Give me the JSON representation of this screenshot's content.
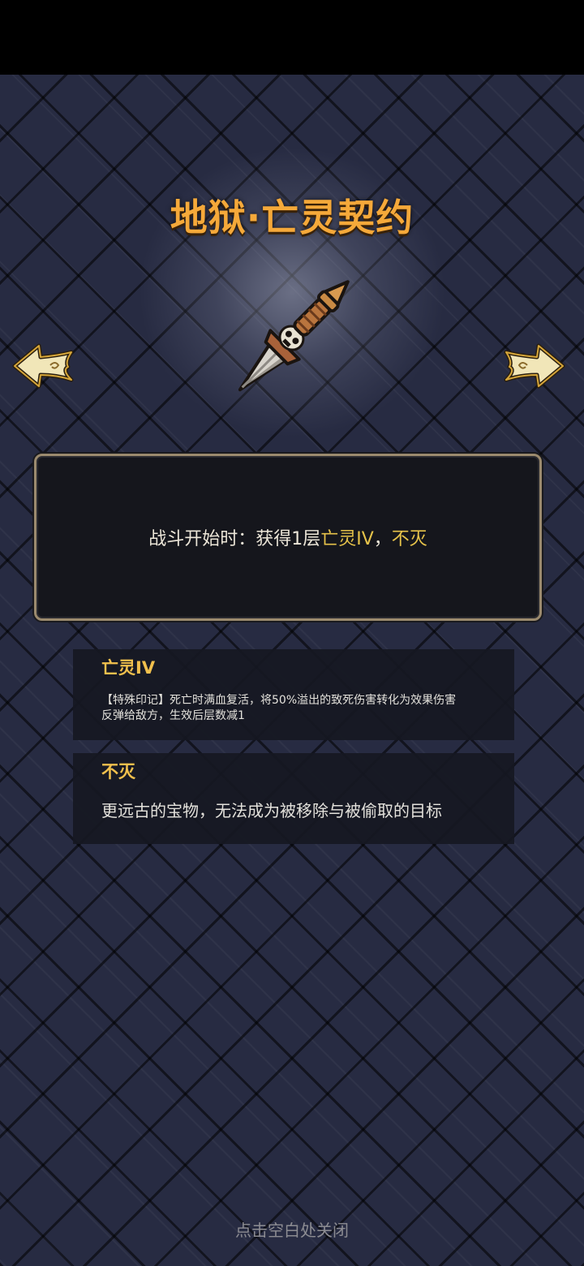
{
  "item": {
    "title": "地狱·亡灵契约",
    "icon": "skull-dagger-icon"
  },
  "navigation": {
    "prev_icon": "left-arrow-icon",
    "next_icon": "right-arrow-icon"
  },
  "effect": {
    "prefix": "战斗开始时：获得1层",
    "keyword1": "亡灵IV",
    "separator": "，",
    "keyword2": "不灭"
  },
  "keywords": [
    {
      "name": "亡灵IV",
      "description_line1": "【特殊印记】死亡时满血复活，将50%溢出的致死伤害转化为效果伤害",
      "description_line2": "反弹给敌方，生效后层数减1"
    },
    {
      "name": "不灭",
      "description": "更远古的宝物，无法成为被移除与被偷取的目标"
    }
  ],
  "close_hint": "点击空白处关闭",
  "colors": {
    "title": "#f5a93a",
    "keyword_highlight": "#e6c34a",
    "panel_border": "#9b8a6e",
    "background": "#272b42"
  }
}
